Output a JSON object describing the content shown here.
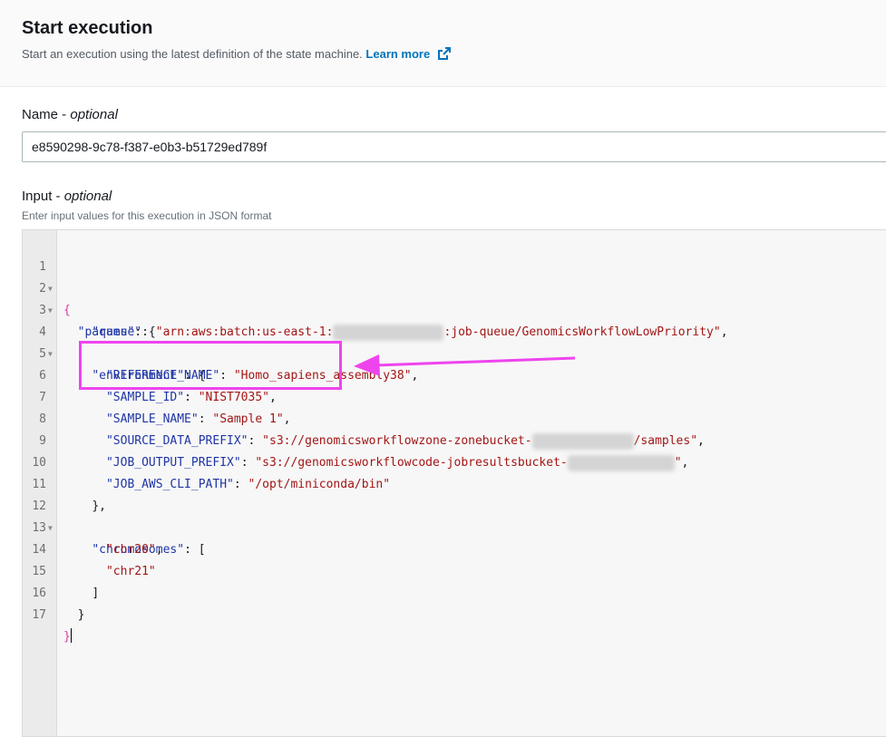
{
  "header": {
    "title": "Start execution",
    "subtitle": "Start an execution using the latest definition of the state machine.",
    "learn_more": "Learn more"
  },
  "name_field": {
    "label": "Name",
    "optional": "optional",
    "value": "e8590298-9c78-f387-e0b3-b51729ed789f"
  },
  "input_field": {
    "label": "Input",
    "optional": "optional",
    "description": "Enter input values for this execution in JSON format"
  },
  "editor": {
    "line_numbers": [
      "1",
      "2",
      "3",
      "4",
      "5",
      "6",
      "7",
      "8",
      "9",
      "10",
      "11",
      "12",
      "13",
      "14",
      "15",
      "16",
      "17"
    ],
    "tokens": {
      "l1_brace": "{",
      "l2_key": "\"params\"",
      "l2_rest": ": {",
      "l3_key": "\"queue\"",
      "l3_sep": ": ",
      "l3_val_a": "\"arn:aws:batch:us-east-1:",
      "l3_val_b": ":job-queue/GenomicsWorkflowLowPriority\"",
      "l3_comma": ",",
      "l4_key": "\"environment\"",
      "l4_rest": ": {",
      "l5_key": "\"REFERENCE_NAME\"",
      "l5_sep": ": ",
      "l5_val": "\"Homo_sapiens_assembly38\"",
      "l5_comma": ",",
      "l6_key": "\"SAMPLE_ID\"",
      "l6_sep": ": ",
      "l6_val": "\"NIST7035\"",
      "l6_comma": ",",
      "l7_key": "\"SAMPLE_NAME\"",
      "l7_sep": ": ",
      "l7_val": "\"Sample 1\"",
      "l7_comma": ",",
      "l8_key": "\"SOURCE_DATA_PREFIX\"",
      "l8_sep": ": ",
      "l8_val_a": "\"s3://genomicsworkflowzone-zonebucket-",
      "l8_val_b": "/samples\"",
      "l8_comma": ",",
      "l9_key": "\"JOB_OUTPUT_PREFIX\"",
      "l9_sep": ": ",
      "l9_val_a": "\"s3://genomicsworkflowcode-jobresultsbucket-",
      "l9_val_b": "\"",
      "l9_comma": ",",
      "l10_key": "\"JOB_AWS_CLI_PATH\"",
      "l10_sep": ": ",
      "l10_val": "\"/opt/miniconda/bin\"",
      "l11": "},",
      "l12_key": "\"chromosomes\"",
      "l12_rest": ": [",
      "l13_val": "\"chr20\"",
      "l13_comma": ",",
      "l14_val": "\"chr21\"",
      "l15": "]",
      "l16": "}",
      "l17_brace": "}"
    }
  },
  "colors": {
    "accent_link": "#0073bb",
    "annotation": "#ee44ee",
    "json_key": "#1f35a6",
    "json_string": "#a31515"
  }
}
